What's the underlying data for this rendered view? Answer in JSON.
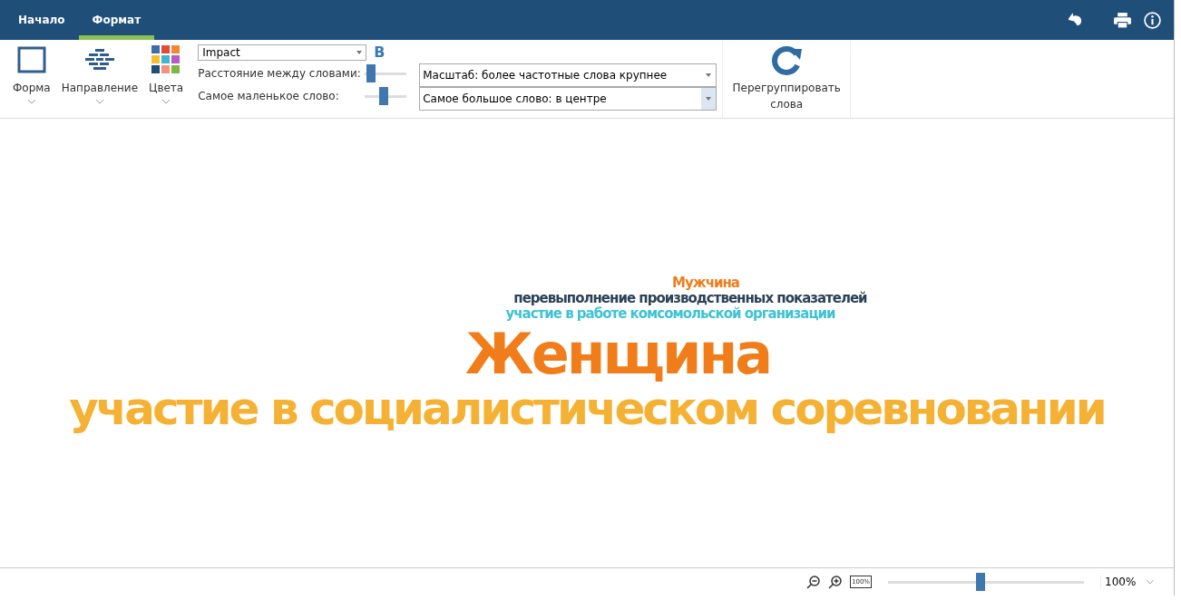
{
  "tabs": [
    {
      "label": "Начало",
      "selected": false
    },
    {
      "label": "Формат",
      "selected": true
    }
  ],
  "ribbon": {
    "buttons": [
      {
        "label": "Форма",
        "kind": "shape"
      },
      {
        "label": "Направление",
        "kind": "direction"
      },
      {
        "label": "Цвета",
        "kind": "colors"
      }
    ],
    "font": {
      "value": "Impact",
      "bold_label": "B"
    },
    "sliders": [
      {
        "label": "Расстояние между словами:",
        "level": 0.15
      },
      {
        "label": "Самое маленькое слово:",
        "level": 0.45
      }
    ],
    "dropdowns": [
      "Масштаб: более частотные слова крупнее",
      "Самое большое слово: в центре"
    ],
    "regroup": "Перегруппировать слова"
  },
  "words": [
    {
      "text": "Мужчина",
      "kind": "small",
      "color": "#f07d1a"
    },
    {
      "text": "перевыполнение производственных показателей",
      "kind": "small",
      "color": "#2d4258"
    },
    {
      "text": "участие в работе комсомольской организации",
      "kind": "small",
      "color": "#3ec3d4"
    },
    {
      "text": "Женщина",
      "kind": "large",
      "color": "#f07d1a"
    },
    {
      "text": "участие в социалистическом соревновании",
      "kind": "huge",
      "color": "#f5b133"
    }
  ],
  "status": {
    "zoom": {
      "level": 0.47
    },
    "zoom_value": "100%",
    "fit_label": "100%"
  }
}
